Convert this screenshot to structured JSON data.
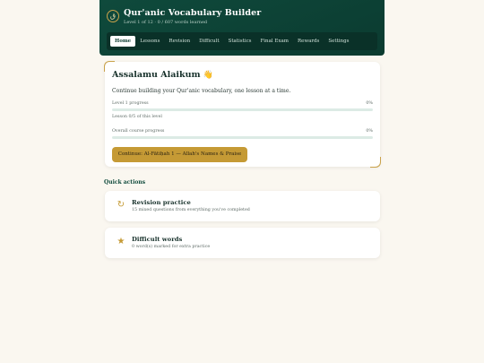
{
  "app": {
    "logo_glyph": "ق",
    "title": "Qur'anic Vocabulary Builder",
    "subtitle": "Level 1 of 12 · 0 / 607 words learned"
  },
  "nav": {
    "tabs": [
      {
        "label": "Home",
        "active": true
      },
      {
        "label": "Lessons"
      },
      {
        "label": "Revision"
      },
      {
        "label": "Difficult"
      },
      {
        "label": "Statistics"
      },
      {
        "label": "Final Exam"
      },
      {
        "label": "Rewards"
      },
      {
        "label": "Settings"
      }
    ]
  },
  "welcome": {
    "greeting": "Assalamu Alaikum",
    "wave_emoji": "👋",
    "lead": "Continue building your Qur'anic vocabulary, one lesson at a time.",
    "level_progress": {
      "label": "Level 1 progress",
      "percent_text": "0%",
      "fraction": 0
    },
    "lesson_caption": "Lesson 0/5 of this level",
    "course_progress": {
      "label": "Overall course progress",
      "percent_text": "0%",
      "fraction": 0
    },
    "cta_label": "Continue: Al-Fātiḥah 1 — Allah's Names & Praise"
  },
  "quick_actions": {
    "title": "Quick actions",
    "items": [
      {
        "icon": "refresh-icon",
        "glyph": "↻",
        "title": "Revision practice",
        "subtitle": "15 mixed questions from everything you've completed"
      },
      {
        "icon": "star-icon",
        "glyph": "★",
        "title": "Difficult words",
        "subtitle": "0 word(s) marked for extra practice"
      }
    ]
  },
  "colors": {
    "header_bg": "#0f4a3c",
    "accent_gold": "#c59a35",
    "page_bg": "#faf7f0"
  }
}
